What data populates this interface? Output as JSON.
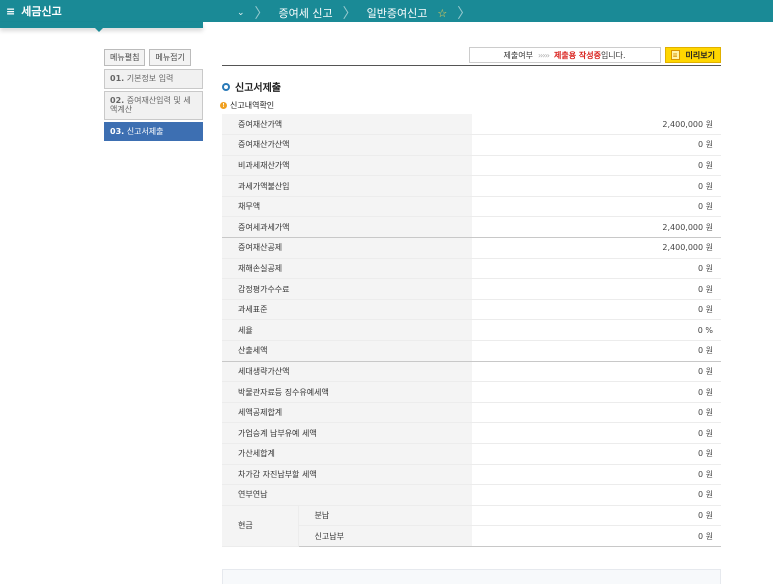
{
  "topbar": {
    "menu_label": "세금신고",
    "crumb1": "증여세 신고",
    "crumb2": "일반증여신고"
  },
  "sidebar": {
    "expand_label": "메뉴펼침",
    "collapse_label": "메뉴접기",
    "steps": [
      {
        "num": "01.",
        "label": "기본정보 입력"
      },
      {
        "num": "02.",
        "label": "증여재산입력 및 세액계산"
      },
      {
        "num": "03.",
        "label": "신고서제출"
      }
    ]
  },
  "status": {
    "prefix": "제출여부",
    "arrows": "›››››",
    "highlight": "제출용 작성중",
    "suffix": "입니다.",
    "preview_label": "미리보기"
  },
  "section": {
    "title": "신고서제출",
    "subtitle": "신고내역확인"
  },
  "rows": [
    {
      "label": "증여재산가액",
      "value": "2,400,000 원"
    },
    {
      "label": "증여재산가산액",
      "value": "0 원"
    },
    {
      "label": "비과세재산가액",
      "value": "0 원"
    },
    {
      "label": "과세가액불산입",
      "value": "0 원"
    },
    {
      "label": "채무액",
      "value": "0 원"
    },
    {
      "label": "증여세과세가액",
      "value": "2,400,000 원"
    },
    {
      "label": "증여재산공제",
      "value": "2,400,000 원"
    },
    {
      "label": "재해손실공제",
      "value": "0 원"
    },
    {
      "label": "감정평가수수료",
      "value": "0 원"
    },
    {
      "label": "과세표준",
      "value": "0 원"
    },
    {
      "label": "세율",
      "value": "0 %"
    },
    {
      "label": "산출세액",
      "value": "0 원"
    },
    {
      "label": "세대생략가산액",
      "value": "0 원"
    },
    {
      "label": "박물관자료등 징수유예세액",
      "value": "0 원"
    },
    {
      "label": "세액공제합계",
      "value": "0 원"
    },
    {
      "label": "가업승계 납부유예 세액",
      "value": "0 원"
    },
    {
      "label": "가산세합계",
      "value": "0 원"
    },
    {
      "label": "차가감 자진납부할 세액",
      "value": "0 원"
    },
    {
      "label": "연부연납",
      "value": "0 원"
    }
  ],
  "cash": {
    "label": "현금",
    "installment_label": "분납",
    "installment_value": "0 원",
    "filing_label": "신고납부",
    "filing_value": "0 원"
  }
}
